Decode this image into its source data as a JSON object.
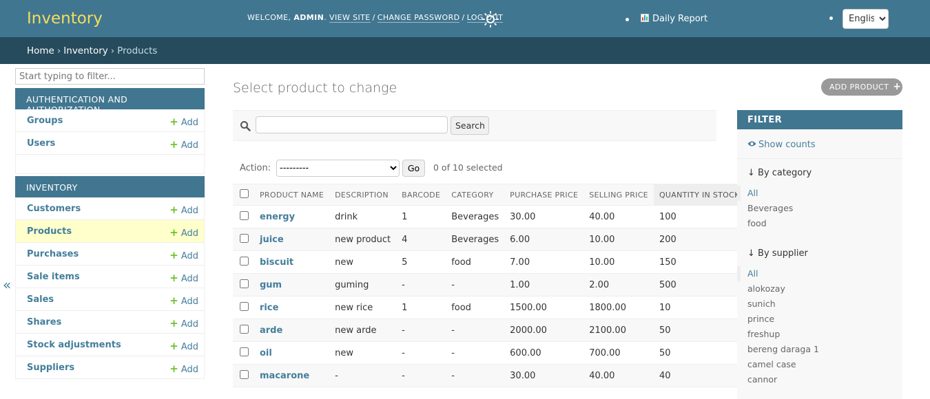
{
  "header": {
    "brand": "Inventory",
    "welcome": "WELCOME,",
    "username": "ADMIN",
    "view_site": "VIEW SITE",
    "change_password": "CHANGE PASSWORD",
    "log_out": "LOG OUT",
    "daily_report": "Daily Report",
    "language": "English"
  },
  "breadcrumbs": {
    "home": "Home",
    "app": "Inventory",
    "current": "Products"
  },
  "sidebar": {
    "filter_placeholder": "Start typing to filter...",
    "add_label": "Add",
    "collapse": "«",
    "apps": [
      {
        "caption": "AUTHENTICATION AND AUTHORIZATION",
        "models": [
          "Groups",
          "Users"
        ]
      },
      {
        "caption": "INVENTORY",
        "models": [
          "Customers",
          "Products",
          "Purchases",
          "Sale items",
          "Sales",
          "Shares",
          "Stock adjustments",
          "Suppliers"
        ]
      }
    ]
  },
  "content": {
    "title": "Select product to change",
    "add_button": "ADD PRODUCT",
    "search_button": "Search",
    "action_label": "Action:",
    "action_default": "---------",
    "go_button": "Go",
    "selected_count": "0 of 10 selected"
  },
  "table": {
    "columns": [
      "PRODUCT NAME",
      "DESCRIPTION",
      "BARCODE",
      "CATEGORY",
      "PURCHASE PRICE",
      "SELLING PRICE",
      "QUANTITY IN STOCK"
    ],
    "rows": [
      [
        "energy",
        "drink",
        "1",
        "Beverages",
        "30.00",
        "40.00",
        "100"
      ],
      [
        "juice",
        "new product",
        "4",
        "Beverages",
        "6.00",
        "10.00",
        "200"
      ],
      [
        "biscuit",
        "new",
        "5",
        "food",
        "7.00",
        "10.00",
        "150"
      ],
      [
        "gum",
        "guming",
        "-",
        "-",
        "1.00",
        "2.00",
        "500"
      ],
      [
        "rice",
        "new rice",
        "1",
        "food",
        "1500.00",
        "1800.00",
        "10"
      ],
      [
        "arde",
        "new arde",
        "-",
        "-",
        "2000.00",
        "2100.00",
        "50"
      ],
      [
        "oil",
        "new",
        "-",
        "-",
        "600.00",
        "700.00",
        "50"
      ],
      [
        "macarone",
        "-",
        "-",
        "-",
        "30.00",
        "40.00",
        "40"
      ]
    ]
  },
  "filter": {
    "title": "FILTER",
    "show_counts": "Show counts",
    "by_category": {
      "title": "↓ By category",
      "options": [
        "All",
        "Beverages",
        "food"
      ]
    },
    "by_supplier": {
      "title": "↓ By supplier",
      "options": [
        "All",
        "alokozay",
        "sunich",
        "prince",
        "freshup",
        "bereng daraga 1",
        "camel case",
        "cannor"
      ]
    }
  },
  "colors": {
    "header_bg": "#417690",
    "breadcrumb_bg": "#264b5d",
    "brand": "#f5dd5d",
    "link": "#447e9b",
    "add_plus": "#70bf2b",
    "current_row": "#ffffcc"
  }
}
